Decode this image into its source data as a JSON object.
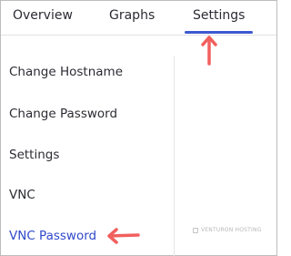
{
  "tabs": [
    {
      "label": "Overview"
    },
    {
      "label": "Graphs"
    },
    {
      "label": "Settings",
      "active": true
    }
  ],
  "sidebar": {
    "items": [
      {
        "label": "Change Hostname"
      },
      {
        "label": "Change Password"
      },
      {
        "label": "Settings"
      },
      {
        "label": "VNC"
      },
      {
        "label": "VNC Password",
        "active": true
      }
    ]
  },
  "watermark": {
    "text": "VENTURON HOSTING"
  },
  "colors": {
    "accent": "#3d5ad1",
    "active_text": "#2f49c9",
    "arrow": "#f0605e"
  }
}
